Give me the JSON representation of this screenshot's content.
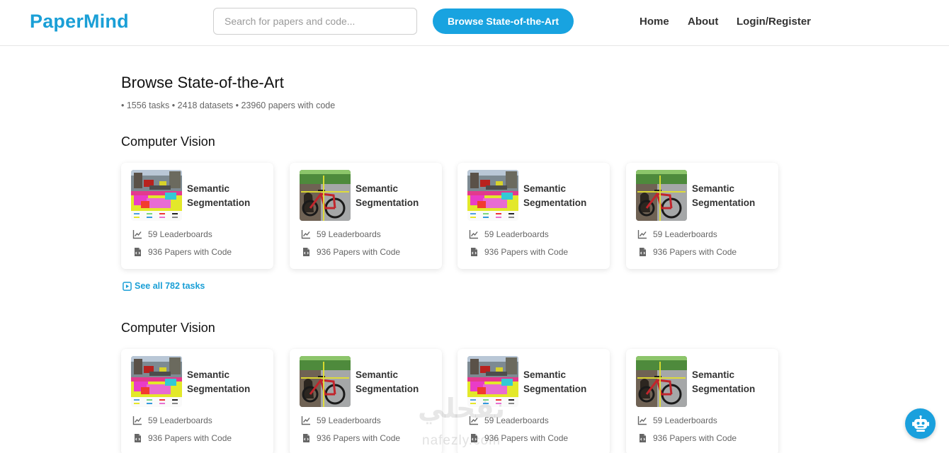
{
  "header": {
    "logo": "PaperMind",
    "search_placeholder": "Search for papers and code...",
    "sota_button": "Browse State-of-the-Art",
    "nav": {
      "home": "Home",
      "about": "About",
      "login": "Login/Register"
    }
  },
  "main": {
    "title": "Browse State-of-the-Art",
    "stats": "• 1556 tasks • 2418 datasets • 23960 papers with code",
    "see_all": "See all 782 tasks",
    "sections": [
      {
        "title": "Computer Vision",
        "cards": [
          {
            "title": "Semantic Segmentation",
            "leaderboards": "59 Leaderboards",
            "papers": "936 Papers with Code",
            "thumb": "street"
          },
          {
            "title": "Semantic Segmentation",
            "leaderboards": "59 Leaderboards",
            "papers": "936 Papers with Code",
            "thumb": "bike"
          },
          {
            "title": "Semantic Segmentation",
            "leaderboards": "59 Leaderboards",
            "papers": "936 Papers with Code",
            "thumb": "street"
          },
          {
            "title": "Semantic Segmentation",
            "leaderboards": "59 Leaderboards",
            "papers": "936 Papers with Code",
            "thumb": "bike"
          }
        ]
      },
      {
        "title": "Computer Vision",
        "cards": [
          {
            "title": "Semantic Segmentation",
            "leaderboards": "59 Leaderboards",
            "papers": "936 Papers with Code",
            "thumb": "street"
          },
          {
            "title": "Semantic Segmentation",
            "leaderboards": "59 Leaderboards",
            "papers": "936 Papers with Code",
            "thumb": "bike"
          },
          {
            "title": "Semantic Segmentation",
            "leaderboards": "59 Leaderboards",
            "papers": "936 Papers with Code",
            "thumb": "street"
          },
          {
            "title": "Semantic Segmentation",
            "leaderboards": "59 Leaderboards",
            "papers": "936 Papers with Code",
            "thumb": "bike"
          }
        ]
      }
    ]
  },
  "watermark": {
    "text": "نفحلي",
    "sub": "nafezly.com"
  },
  "colors": {
    "brand": "#1a9fd6",
    "button": "#18a3e0",
    "text": "#333333",
    "muted": "#666666"
  },
  "icons": {
    "leaderboards": "line-chart-icon",
    "papers": "file-code-icon",
    "see_all": "play-square-icon",
    "chat": "robot-icon"
  }
}
